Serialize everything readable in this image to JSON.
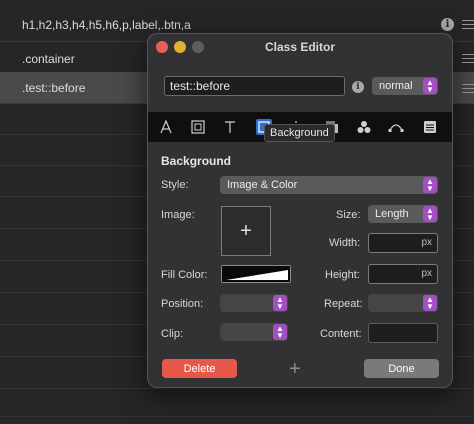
{
  "background_list": {
    "rows": [
      {
        "label": "h1,h2,h3,h4,h5,h6,p,label,.btn,a"
      },
      {
        "label": ".container"
      },
      {
        "label": ".test::before"
      }
    ],
    "info_glyph": "i"
  },
  "dialog": {
    "title": "Class Editor",
    "name_value": "test::before",
    "info_glyph": "i",
    "state_select": "normal",
    "tooltip": "Background",
    "section_title": "Background",
    "style_label": "Style:",
    "style_value": "Image & Color",
    "image_label": "Image:",
    "image_add": "+",
    "size_label": "Size:",
    "size_value": "Length",
    "width_label": "Width:",
    "width_unit": "px",
    "fill_color_label": "Fill Color:",
    "height_label": "Height:",
    "height_unit": "px",
    "position_label": "Position:",
    "repeat_label": "Repeat:",
    "clip_label": "Clip:",
    "content_label": "Content:",
    "delete_label": "Delete",
    "add_label": "+",
    "done_label": "Done",
    "tools": [
      "text-font-icon",
      "box-icon",
      "typography-icon",
      "background-icon",
      "position-icon",
      "layers-icon",
      "effects-icon",
      "transform-icon",
      "grid-icon"
    ],
    "colors": {
      "accent": "#a24fc2",
      "delete": "#e8584a",
      "active_tool": "#2f6fd6"
    }
  }
}
